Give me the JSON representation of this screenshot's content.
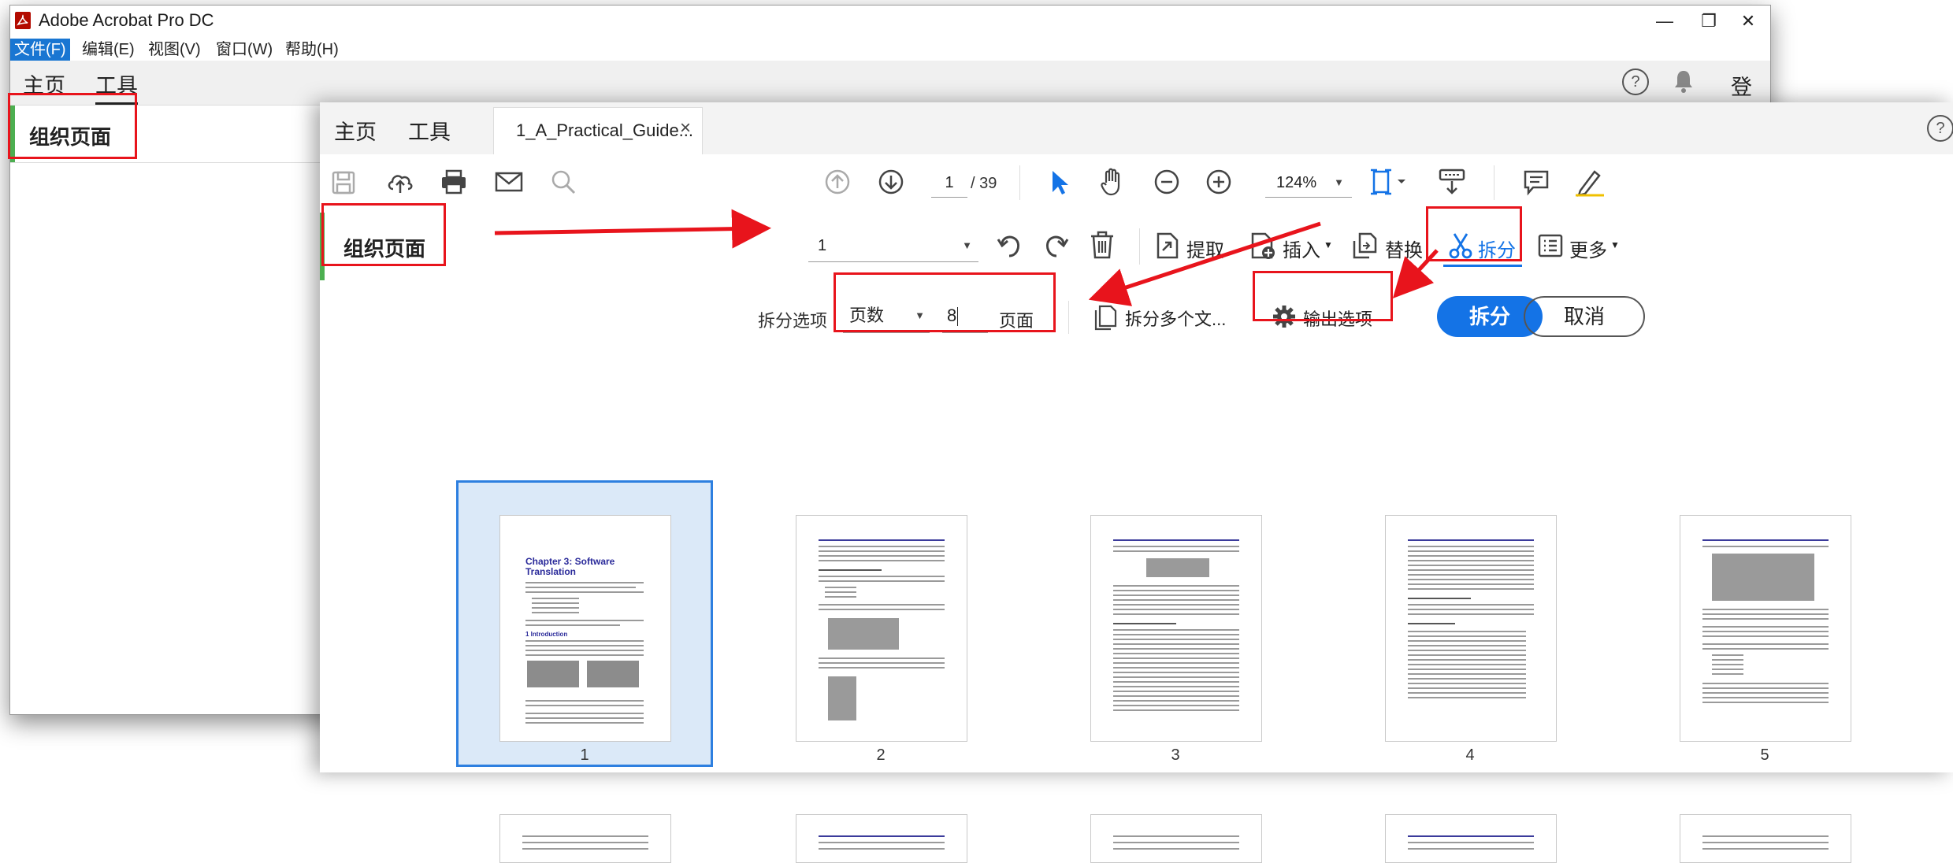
{
  "app": {
    "title": "Adobe Acrobat Pro DC",
    "window_controls": [
      "—",
      "❐",
      "✕"
    ]
  },
  "menu": [
    "文件(F)",
    "编辑(E)",
    "视图(V)",
    "窗口(W)",
    "帮助(H)"
  ],
  "back_tabs": {
    "home": "主页",
    "tools": "工具"
  },
  "back_header": {
    "help_icon": "?",
    "bell_icon": "bell",
    "login": "登录"
  },
  "back_panel": {
    "title": "组织页面"
  },
  "front_tabs": {
    "home": "主页",
    "tools": "工具",
    "document": "1_A_Practical_Guide...",
    "close": "×"
  },
  "toolbar": {
    "page_current": "1",
    "page_total": "/ 39",
    "zoom": "124%"
  },
  "organize": {
    "title": "组织页面",
    "page_select": "1",
    "extract": "提取",
    "insert": "插入",
    "replace": "替换",
    "split": "拆分",
    "more": "更多"
  },
  "split_options": {
    "label": "拆分选项",
    "type_select": "页数",
    "count_value": "8",
    "pages_label": "页面",
    "split_multiple": "拆分多个文...",
    "output_options": "输出选项",
    "split_button": "拆分",
    "cancel_button": "取消"
  },
  "thumbnails": [
    {
      "number": "1",
      "title": "Chapter 3: Software Translation"
    },
    {
      "number": "2"
    },
    {
      "number": "3"
    },
    {
      "number": "4"
    },
    {
      "number": "5"
    }
  ],
  "colors": {
    "accent": "#1473e6",
    "annotation": "#e8141c",
    "green": "#4caf50",
    "adobe_red": "#b30b00"
  }
}
